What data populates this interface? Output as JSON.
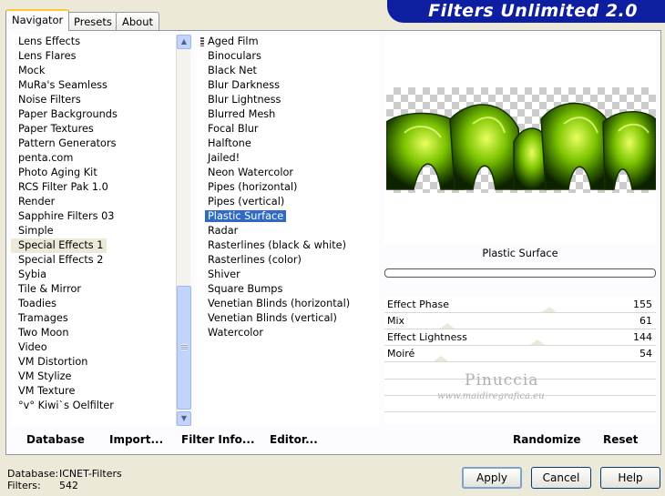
{
  "banner": {
    "title": "Filters Unlimited 2.0"
  },
  "tabs": [
    {
      "label": "Navigator"
    },
    {
      "label": "Presets"
    },
    {
      "label": "About"
    }
  ],
  "categories": [
    "Lens Effects",
    "Lens Flares",
    "Mock",
    "MuRa's Seamless",
    "Noise Filters",
    "Paper Backgrounds",
    "Paper Textures",
    "Pattern Generators",
    "penta.com",
    "Photo Aging Kit",
    "RCS Filter Pak 1.0",
    "Render",
    "Sapphire Filters 03",
    "Simple",
    "Special Effects 1",
    "Special Effects 2",
    "Sybia",
    "Tile & Mirror",
    "Toadies",
    "Tramages",
    "Two Moon",
    "Video",
    "VM Distortion",
    "VM Stylize",
    "VM Texture",
    "°v° Kiwi`s Oelfilter"
  ],
  "selected_category": "Special Effects 1",
  "filters": [
    "Aged Film",
    "Binoculars",
    "Black Net",
    "Blur Darkness",
    "Blur Lightness",
    "Blurred Mesh",
    "Focal Blur",
    "Halftone",
    "Jailed!",
    "Neon Watercolor",
    "Pipes (horizontal)",
    "Pipes (vertical)",
    "Plastic Surface",
    "Radar",
    "Rasterlines (black & white)",
    "Rasterlines (color)",
    "Shiver",
    "Square Bumps",
    "Venetian Blinds (horizontal)",
    "Venetian Blinds (vertical)",
    "Watercolor"
  ],
  "selected_filter": "Plastic Surface",
  "preview": {
    "filter_name": "Plastic Surface"
  },
  "params": [
    {
      "label": "Effect Phase",
      "value": "155"
    },
    {
      "label": "Mix",
      "value": "61"
    },
    {
      "label": "Effect Lightness",
      "value": "144"
    },
    {
      "label": "Moiré",
      "value": "54"
    }
  ],
  "watermark": {
    "name": "Pinuccia",
    "url": "www.maidiregrafica.eu"
  },
  "actions": {
    "database": "Database",
    "import": "Import...",
    "filter_info": "Filter Info...",
    "editor": "Editor...",
    "randomize": "Randomize",
    "reset": "Reset"
  },
  "status": {
    "database_label": "Database:",
    "database_value": "ICNET-Filters",
    "filters_label": "Filters:",
    "filters_value": "542"
  },
  "buttons": {
    "apply": "Apply",
    "cancel": "Cancel",
    "help": "Help"
  },
  "colors": {
    "banner": "#0d1fa0",
    "selection": "#316ac5",
    "dialog_bg": "#ece9d8"
  }
}
